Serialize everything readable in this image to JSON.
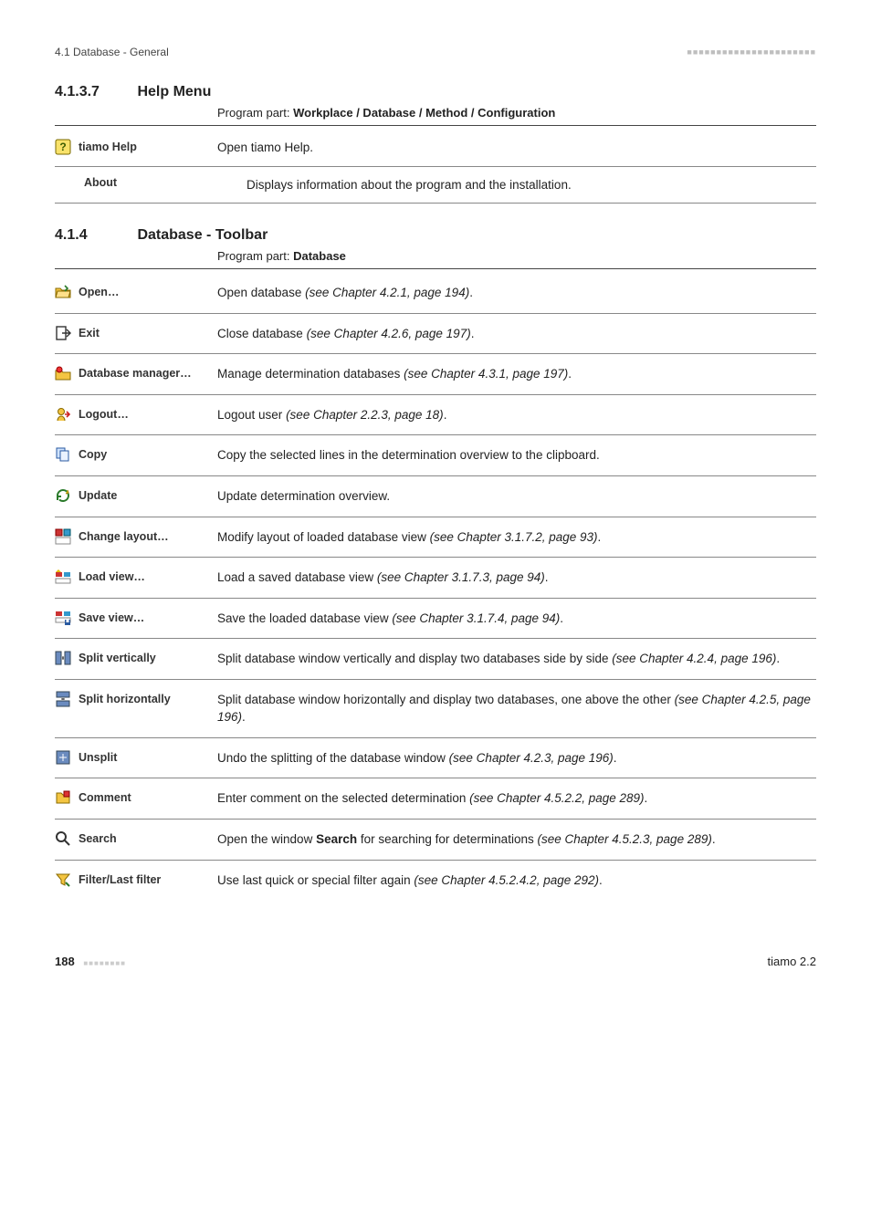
{
  "header": {
    "left": "4.1 Database - General"
  },
  "section1": {
    "number": "4.1.3.7",
    "title": "Help Menu",
    "program_part_label": "Program part: ",
    "program_part_value": "Workplace / Database / Method / Configuration",
    "rows": [
      {
        "label": "tiamo Help",
        "desc": "Open tiamo Help."
      },
      {
        "label": "About",
        "desc": "Displays information about the program and the installation."
      }
    ]
  },
  "section2": {
    "number": "4.1.4",
    "title": "Database - Toolbar",
    "program_part_label": "Program part: ",
    "program_part_value": "Database",
    "rows": [
      {
        "label": "Open…",
        "desc_pre": "Open database ",
        "desc_em": "(see Chapter 4.2.1, page 194)",
        "desc_post": "."
      },
      {
        "label": "Exit",
        "desc_pre": "Close database ",
        "desc_em": "(see Chapter 4.2.6, page 197)",
        "desc_post": "."
      },
      {
        "label": "Database manager…",
        "desc_pre": "Manage determination databases ",
        "desc_em": "(see Chapter 4.3.1, page 197)",
        "desc_post": "."
      },
      {
        "label": "Logout…",
        "desc_pre": "Logout user ",
        "desc_em": "(see Chapter 2.2.3, page 18)",
        "desc_post": "."
      },
      {
        "label": "Copy",
        "desc_pre": "Copy the selected lines in the determination overview to the clipboard.",
        "desc_em": "",
        "desc_post": ""
      },
      {
        "label": "Update",
        "desc_pre": "Update determination overview.",
        "desc_em": "",
        "desc_post": ""
      },
      {
        "label": "Change layout…",
        "desc_pre": "Modify layout of loaded database view ",
        "desc_em": "(see Chapter 3.1.7.2, page 93)",
        "desc_post": "."
      },
      {
        "label": "Load view…",
        "desc_pre": "Load a saved database view ",
        "desc_em": "(see Chapter 3.1.7.3, page 94)",
        "desc_post": "."
      },
      {
        "label": "Save view…",
        "desc_pre": "Save the loaded database view ",
        "desc_em": "(see Chapter 3.1.7.4, page 94)",
        "desc_post": "."
      },
      {
        "label": "Split vertically",
        "desc_pre": "Split database window vertically and display two databases side by side ",
        "desc_em": "(see Chapter 4.2.4, page 196)",
        "desc_post": "."
      },
      {
        "label": "Split horizontally",
        "desc_pre": "Split database window horizontally and display two databases, one above the other ",
        "desc_em": "(see Chapter 4.2.5, page 196)",
        "desc_post": "."
      },
      {
        "label": "Unsplit",
        "desc_pre": "Undo the splitting of the database window ",
        "desc_em": "(see Chapter 4.2.3, page 196)",
        "desc_post": "."
      },
      {
        "label": "Comment",
        "desc_pre": "Enter comment on the selected determination ",
        "desc_em": "(see Chapter 4.5.2.2, page 289)",
        "desc_post": "."
      },
      {
        "label": "Search",
        "desc_pre": "Open the window ",
        "desc_bold": "Search",
        "desc_mid": " for searching for determinations ",
        "desc_em": "(see Chapter 4.5.2.3, page 289)",
        "desc_post": "."
      },
      {
        "label": "Filter/Last filter",
        "desc_pre": "Use last quick or special filter again ",
        "desc_em": "(see Chapter 4.5.2.4.2, page 292)",
        "desc_post": "."
      }
    ]
  },
  "footer": {
    "page": "188",
    "product": "tiamo 2.2"
  }
}
